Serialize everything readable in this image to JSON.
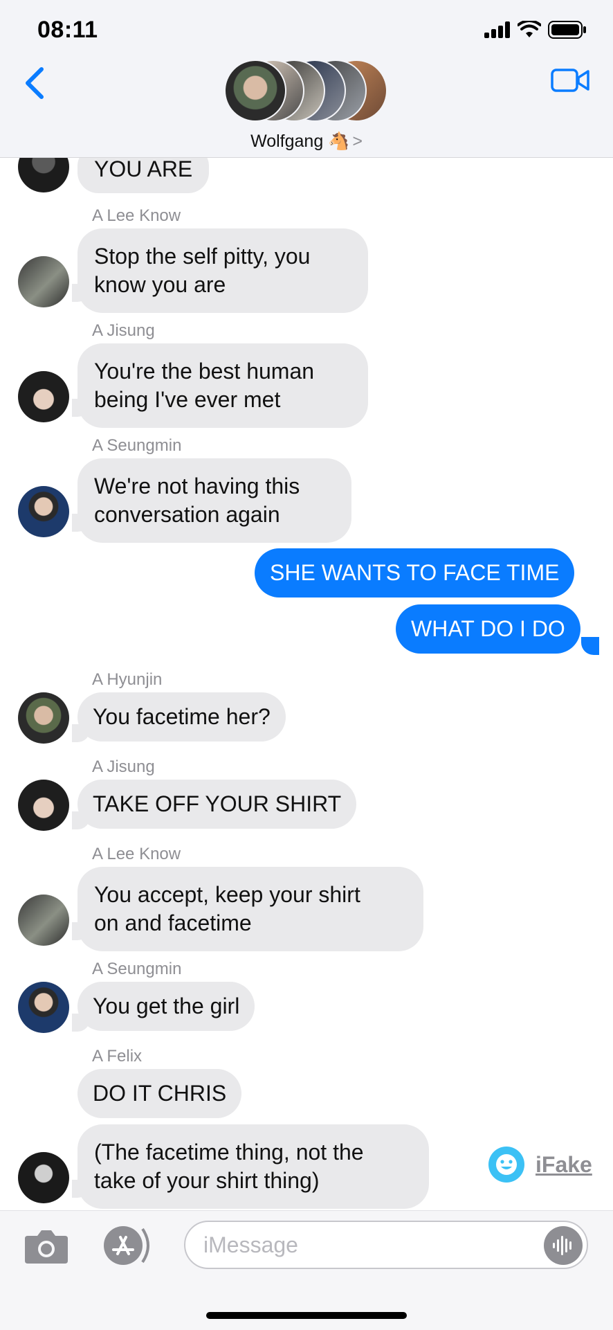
{
  "status": {
    "time": "08:11"
  },
  "header": {
    "group_name": "Wolfgang 🐴",
    "chevron": ">"
  },
  "messages": [
    {
      "type": "in",
      "text": "YOU ARE"
    },
    {
      "type": "in",
      "sender": "A Lee Know",
      "lines": [
        "Stop the self pitty, you",
        "know you are"
      ]
    },
    {
      "type": "in",
      "sender": "A Jisung",
      "lines": [
        "You're the best human",
        "being I've ever met"
      ]
    },
    {
      "type": "in",
      "sender": "A Seungmin",
      "lines": [
        "We're not having this",
        "conversation again"
      ]
    },
    {
      "type": "out",
      "text": "SHE WANTS TO FACE TIME"
    },
    {
      "type": "out",
      "text": "WHAT DO I DO"
    },
    {
      "type": "in",
      "sender": "A Hyunjin",
      "text": "You facetime her?"
    },
    {
      "type": "in",
      "sender": "A Jisung",
      "text": "TAKE OFF YOUR SHIRT"
    },
    {
      "type": "in",
      "sender": "A Lee Know",
      "lines": [
        "You accept, keep your shirt",
        "on and facetime"
      ]
    },
    {
      "type": "in",
      "sender": "A Seungmin",
      "text": "You get the girl"
    },
    {
      "type": "in",
      "sender": "A Felix",
      "text": "DO IT CHRIS"
    },
    {
      "type": "in",
      "lines": [
        "(The facetime thing, not the",
        "take of your shirt thing)"
      ]
    }
  ],
  "watermark": {
    "text": "iFake"
  },
  "input": {
    "placeholder": "iMessage"
  },
  "colors": {
    "outgoing": "#0a7cff",
    "incoming": "#e9e9eb",
    "accent": "#0a7cff"
  },
  "icons": [
    "back-chevron-icon",
    "video-camera-icon",
    "camera-icon",
    "app-store-icon",
    "audio-waveform-icon",
    "signal-icon",
    "wifi-icon",
    "battery-icon"
  ]
}
